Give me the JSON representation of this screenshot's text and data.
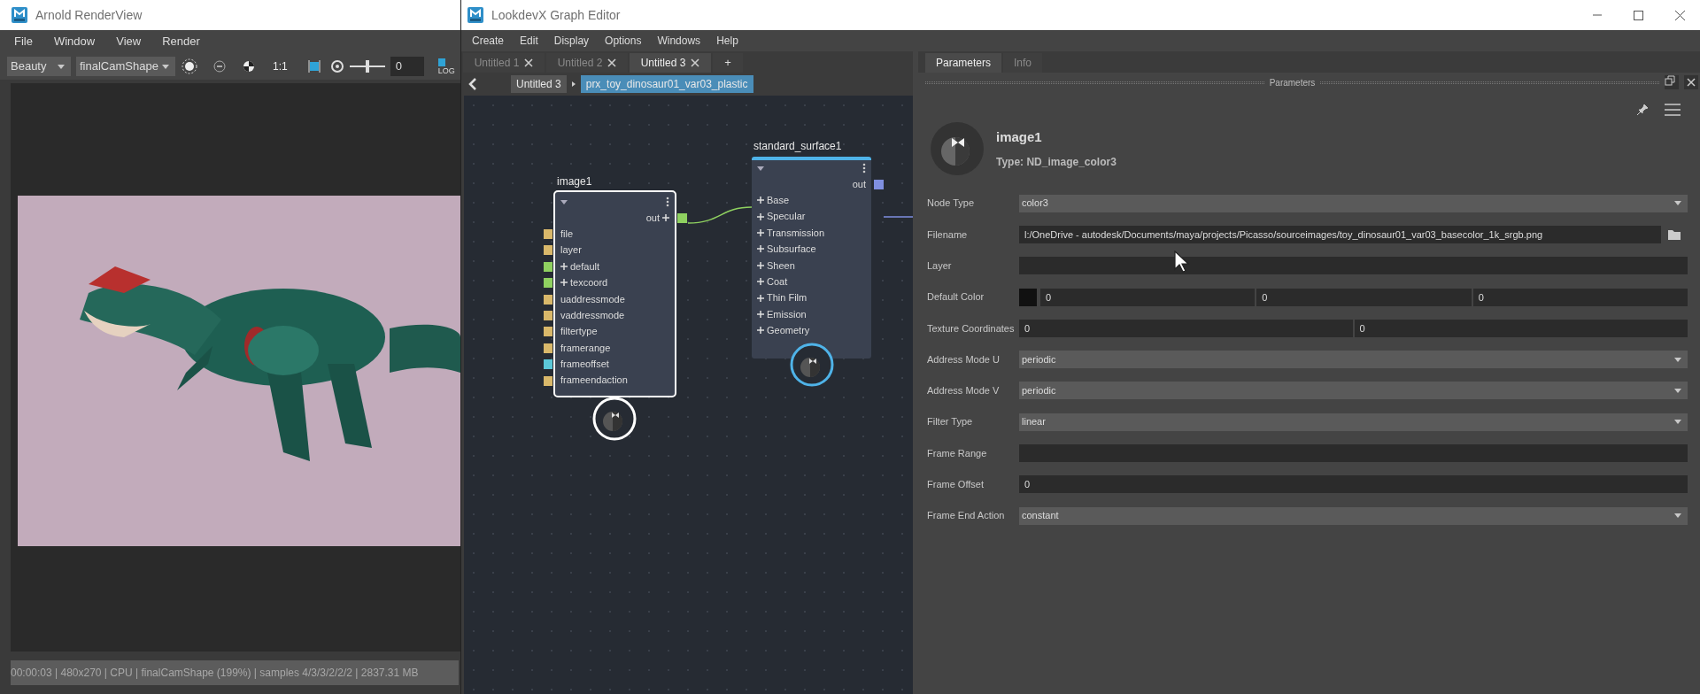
{
  "render_view": {
    "title": "Arnold RenderView",
    "menu": [
      "File",
      "Window",
      "View",
      "Render"
    ],
    "toolbar": {
      "aov": "Beauty",
      "camera": "finalCamShape",
      "ratio": "1:1",
      "exposure_slider": {
        "level": 0.5
      },
      "exposure": "0",
      "log": "LOG"
    },
    "status": "00:00:03 | 480x270 | CPU | finalCamShape (199%) | samples 4/3/3/2/2/2 | 2837.31 MB"
  },
  "graph_editor": {
    "title": "LookdevX Graph Editor",
    "menu": [
      "Create",
      "Edit",
      "Display",
      "Options",
      "Windows",
      "Help"
    ],
    "tabs": [
      {
        "label": "Untitled 1",
        "selected": false
      },
      {
        "label": "Untitled 2",
        "selected": false
      },
      {
        "label": "Untitled 3",
        "selected": true
      }
    ],
    "add_tab": "+",
    "breadcrumb": [
      {
        "label": "Untitled 3",
        "selected": false
      },
      {
        "label": "prx_toy_dinosaur01_var03_plastic",
        "selected": true
      }
    ],
    "nodes": [
      {
        "title": "image1",
        "kind": "texture",
        "selected": true,
        "output": {
          "label": "out",
          "expandable": true,
          "color": "#8fd160"
        },
        "ports": [
          {
            "label": "file",
            "expandable": false,
            "color": "#d9b86a"
          },
          {
            "label": "layer",
            "expandable": false,
            "color": "#d9b86a"
          },
          {
            "label": "default",
            "expandable": true,
            "color": "#8fd160"
          },
          {
            "label": "texcoord",
            "expandable": true,
            "color": "#8fd160"
          },
          {
            "label": "uaddressmode",
            "expandable": false,
            "color": "#d9b86a"
          },
          {
            "label": "vaddressmode",
            "expandable": false,
            "color": "#d9b86a"
          },
          {
            "label": "filtertype",
            "expandable": false,
            "color": "#d9b86a"
          },
          {
            "label": "framerange",
            "expandable": false,
            "color": "#d9b86a"
          },
          {
            "label": "frameoffset",
            "expandable": false,
            "color": "#5bc8d8"
          },
          {
            "label": "frameendaction",
            "expandable": false,
            "color": "#d9b86a"
          }
        ]
      },
      {
        "title": "standard_surface1",
        "kind": "material",
        "selected": false,
        "output": {
          "label": "out",
          "expandable": false,
          "color": "#7f8fe0"
        },
        "ports": [
          {
            "label": "Base",
            "expandable": true
          },
          {
            "label": "Specular",
            "expandable": true
          },
          {
            "label": "Transmission",
            "expandable": true
          },
          {
            "label": "Subsurface",
            "expandable": true
          },
          {
            "label": "Sheen",
            "expandable": true
          },
          {
            "label": "Coat",
            "expandable": true
          },
          {
            "label": "Thin Film",
            "expandable": true
          },
          {
            "label": "Emission",
            "expandable": true
          },
          {
            "label": "Geometry",
            "expandable": true
          }
        ]
      }
    ],
    "parameters_panel": {
      "tabs": [
        {
          "label": "Parameters",
          "selected": true
        },
        {
          "label": "Info",
          "selected": false
        }
      ],
      "header": "Parameters",
      "node_name": "image1",
      "node_type": "Type: ND_image_color3",
      "rows": [
        {
          "label": "Node Type",
          "kind": "dropdown",
          "value": "color3"
        },
        {
          "label": "Filename",
          "kind": "file",
          "value": "l:/OneDrive - autodesk/Documents/maya/projects/Picasso/sourceimages/toy_dinosaur01_var03_basecolor_1k_srgb.png"
        },
        {
          "label": "Layer",
          "kind": "text"
        },
        {
          "label": "Default Color",
          "kind": "color",
          "color": "#111111",
          "values": [
            "0",
            "0",
            "0"
          ]
        },
        {
          "label": "Texture Coordinates",
          "kind": "vector",
          "values": [
            "0",
            "0"
          ]
        },
        {
          "label": "Address Mode U",
          "kind": "dropdown",
          "value": "periodic"
        },
        {
          "label": "Address Mode V",
          "kind": "dropdown",
          "value": "periodic"
        },
        {
          "label": "Filter Type",
          "kind": "dropdown",
          "value": "linear"
        },
        {
          "label": "Frame Range",
          "kind": "text"
        },
        {
          "label": "Frame Offset",
          "kind": "text",
          "value": "0"
        },
        {
          "label": "Frame End Action",
          "kind": "dropdown",
          "value": "constant"
        }
      ]
    }
  }
}
